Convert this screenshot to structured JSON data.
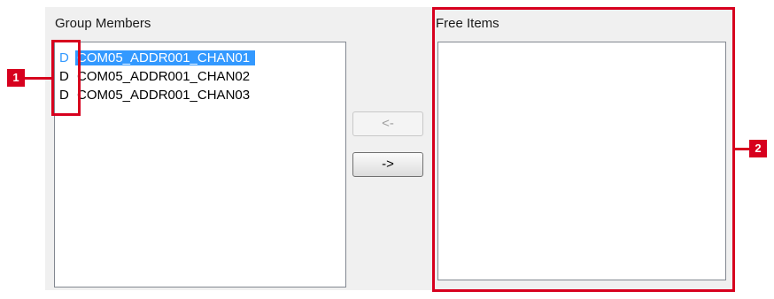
{
  "group_members": {
    "label": "Group Members",
    "items": [
      {
        "type": "D",
        "name": "COM05_ADDR001_CHAN01",
        "selected": true
      },
      {
        "type": "D",
        "name": "COM05_ADDR001_CHAN02",
        "selected": false
      },
      {
        "type": "D",
        "name": "COM05_ADDR001_CHAN03",
        "selected": false
      }
    ]
  },
  "free_items": {
    "label": "Free Items",
    "items": []
  },
  "buttons": {
    "move_left_label": "<-",
    "move_right_label": "->"
  },
  "callouts": {
    "callout_1": "1",
    "callout_2": "2"
  },
  "colors": {
    "selection": "#3399ff",
    "callout": "#d7001e"
  }
}
